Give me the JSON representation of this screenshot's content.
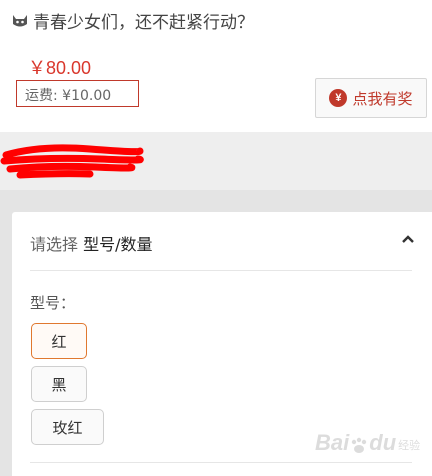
{
  "header": {
    "headline": "青春少女们，还不赶紧行动？"
  },
  "product": {
    "price": "￥80.00",
    "shipping": "运费: ¥10.00",
    "reward_button_label": "点我有奖",
    "reward_icon_glyph": "¥"
  },
  "selector": {
    "prefix": "请选择",
    "title": "型号/数量",
    "model_label": "型号：",
    "options": [
      {
        "label": "红",
        "selected": true
      },
      {
        "label": "黑",
        "selected": false
      },
      {
        "label": "玫红",
        "selected": false
      }
    ]
  },
  "watermark": {
    "brand": "Bai",
    "paw": "du",
    "sub": "经验"
  },
  "colors": {
    "price": "#d9372c",
    "accent": "#c0392b",
    "selected_border": "#e0782f",
    "redaction": "#ff0000"
  }
}
